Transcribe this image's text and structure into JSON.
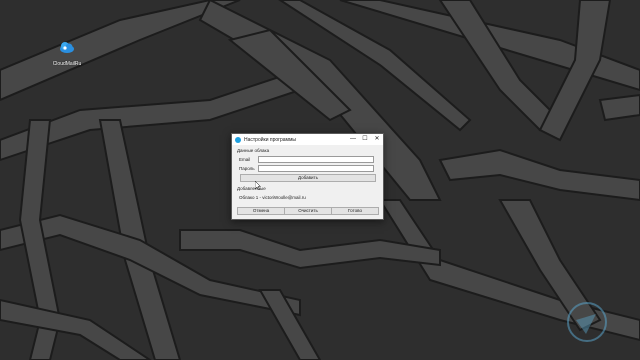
{
  "desktop": {
    "icon": {
      "name": "cloud-icon",
      "label": "CloudMailRu"
    }
  },
  "dialog": {
    "title": "Настройки программы",
    "controls": {
      "minimize": "—",
      "maximize": "☐",
      "close": "✕"
    },
    "section_cloud": "Данные облака",
    "email_label": "Email",
    "email_value": "",
    "password_label": "Пароль",
    "password_value": "",
    "add_button": "Добавить",
    "section_added": "Добавленные",
    "added_item": "Облако 1 - victoriWoolle@mail.ru",
    "cancel_button": "Отмена",
    "clear_button": "Очистить",
    "done_button": "Готово"
  },
  "colors": {
    "accent": "#1ea0e0",
    "wallpaper": "#3a3a3a"
  }
}
